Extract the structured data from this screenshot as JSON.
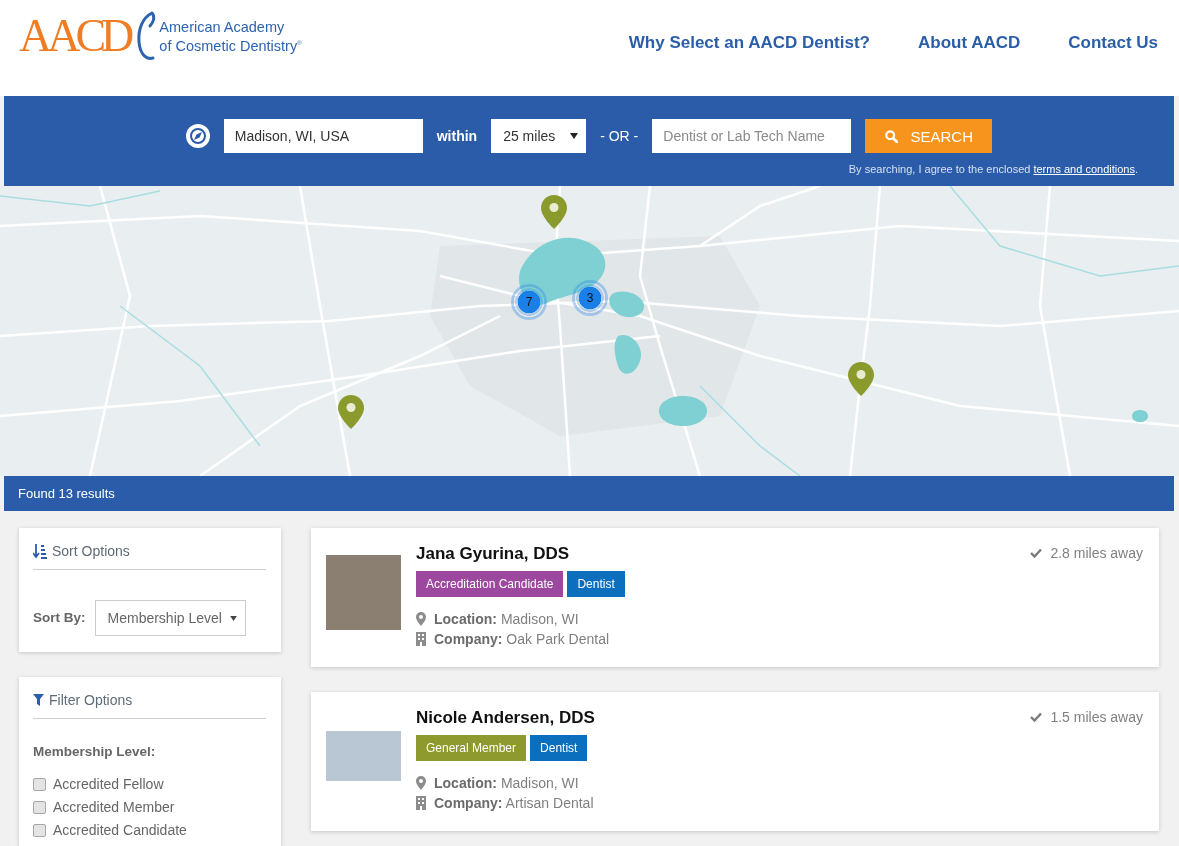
{
  "header": {
    "logo": {
      "mark": "AACD",
      "line_1": "American Academy",
      "line_2": "of Cosmetic Dentistry$^{®}$"
    },
    "nav": [
      "Why Select an AACD Dentist?",
      "About AACD",
      "Contact Us"
    ]
  },
  "search": {
    "location": {
      "value": "Madison, WI, USA"
    },
    "within_label": "within",
    "radius": {
      "value": "25 miles"
    },
    "or_label": "- OR -",
    "name": {
      "placeholder": "Dentist or Lab Tech Name"
    },
    "button": "SEARCH",
    "terms": {
      "before": "By searching, I agree to the enclosed",
      "link": "terms and conditions",
      "after": "."
    }
  },
  "map": {
    "clusters": [
      {
        "count": "7"
      },
      {
        "count": "3"
      }
    ]
  },
  "results_bar": "Found 13 results",
  "sort_options": {
    "title": "Sort Options",
    "label": "Sort By:",
    "value": "Membership Level"
  },
  "filter_options": {
    "title": "Filter Options",
    "group_label": "Membership Level:",
    "items": [
      {
        "label": "Accredited Fellow",
        "checked": false
      },
      {
        "label": "Accredited Member",
        "checked": false
      },
      {
        "label": "Accredited Candidate",
        "checked": false
      }
    ]
  },
  "results": [
    {
      "name": "Jana Gyurina, DDS",
      "badges": [
        {
          "label": "Accreditation Candidate",
          "color": "#9b489e"
        },
        {
          "label": "Dentist",
          "color": "#0b6fbd"
        }
      ],
      "location": "**Location:** Madison, WI",
      "company": "**Company:** Oak Park Dental",
      "distance": "2.8 miles away"
    },
    {
      "name": "Nicole Andersen, DDS",
      "badges": [
        {
          "label": "General Member",
          "color": "#8f9a2e"
        },
        {
          "label": "Dentist",
          "color": "#0b6fbd"
        }
      ],
      "location": "**Location:** Madison, WI",
      "company": "**Company:** Artisan Dental",
      "distance": "1.5 miles away"
    }
  ]
}
